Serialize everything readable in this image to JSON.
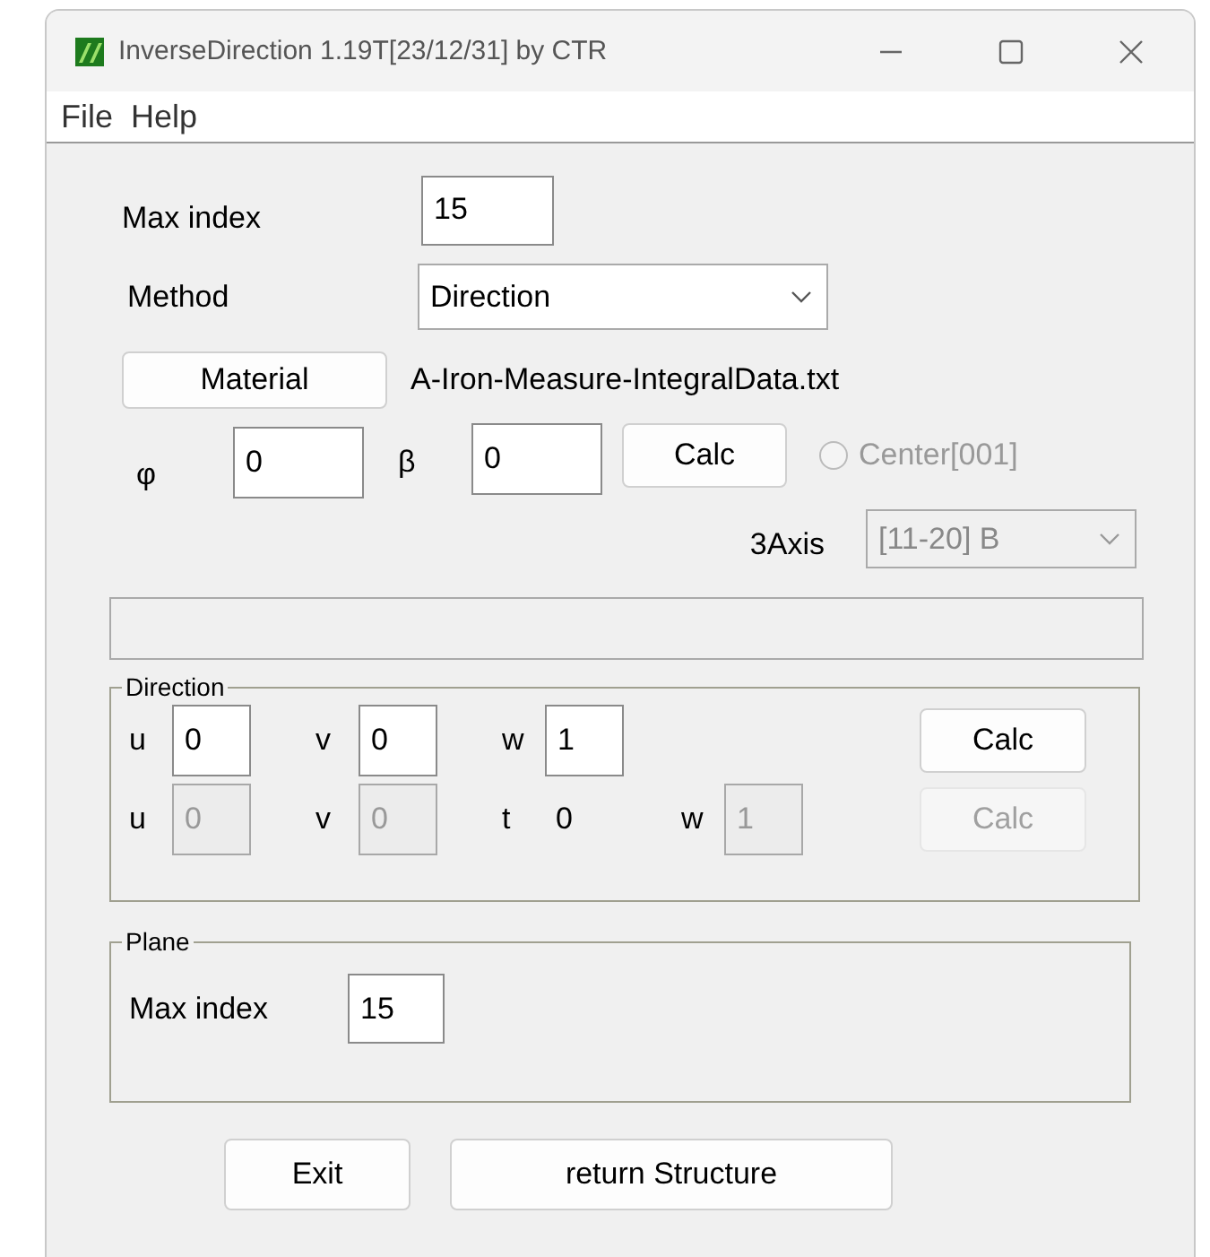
{
  "window": {
    "title": "InverseDirection 1.19T[23/12/31] by CTR"
  },
  "menu": [
    {
      "label": "File"
    },
    {
      "label": "Help"
    }
  ],
  "max_index": {
    "label": "Max index",
    "value": "15"
  },
  "method": {
    "label": "Method",
    "value": "Direction"
  },
  "material": {
    "button": "Material",
    "file": "A-Iron-Measure-IntegralData.txt"
  },
  "angles": [
    {
      "label": "φ",
      "value": "0"
    },
    {
      "label": "β",
      "value": "0"
    }
  ],
  "angle_calc": {
    "label": "Calc",
    "disabled": false
  },
  "center": {
    "label": "Center[001]",
    "checked": false,
    "disabled": true
  },
  "axis": {
    "label": "3Axis",
    "value": "[11-20] B",
    "disabled": true
  },
  "direction": {
    "title": "Direction",
    "rows": [
      {
        "items": [
          {
            "kind": "field",
            "label": "u",
            "value": "0",
            "disabled": false
          },
          {
            "kind": "field",
            "label": "v",
            "value": "0",
            "disabled": false
          },
          {
            "kind": "field",
            "label": "w",
            "value": "1",
            "disabled": false
          }
        ],
        "button": {
          "label": "Calc",
          "disabled": false
        }
      },
      {
        "items": [
          {
            "kind": "field",
            "label": "u",
            "value": "0",
            "disabled": true
          },
          {
            "kind": "field",
            "label": "v",
            "value": "0",
            "disabled": true
          },
          {
            "kind": "reading",
            "label": "t",
            "value": "0"
          },
          {
            "kind": "field",
            "label": "w",
            "value": "1",
            "disabled": true
          }
        ],
        "button": {
          "label": "Calc",
          "disabled": true
        }
      }
    ]
  },
  "plane": {
    "title": "Plane",
    "label": "Max index",
    "value": "15"
  },
  "buttons": [
    {
      "label": "Exit"
    },
    {
      "label": "return Structure"
    }
  ]
}
